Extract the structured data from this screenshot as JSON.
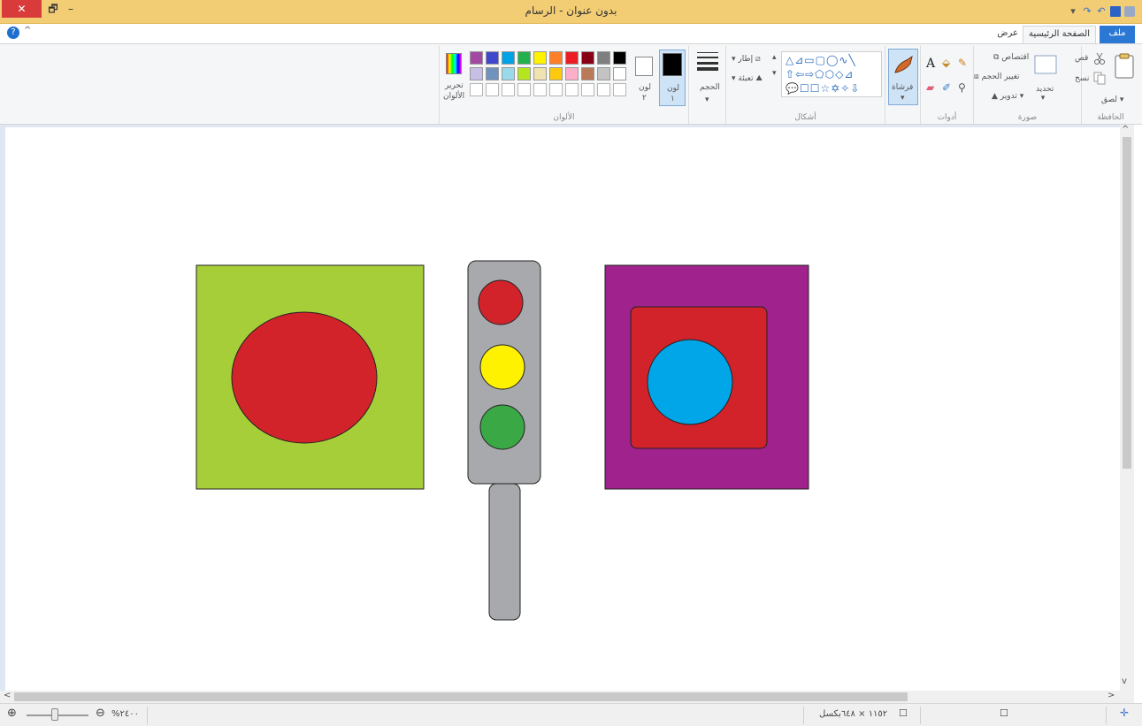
{
  "window": {
    "title": "بدون عنوان - الرسام",
    "close_glyph": "✕",
    "restore_glyph": "🗗",
    "minimize_glyph": "–"
  },
  "tabs": {
    "file": "ملف",
    "home": "الصفحة الرئيسية",
    "view": "عرض"
  },
  "ribbon": {
    "clipboard": {
      "label": "الحافظة",
      "paste": "لصق",
      "cut": "قص",
      "copy": "نسخ"
    },
    "image": {
      "label": "صورة",
      "select": "تحديد",
      "crop": "اقتصاص",
      "resize": "تغيير الحجم",
      "rotate": "تدوير"
    },
    "tools": {
      "label": "أدوات",
      "text_glyph": "A"
    },
    "brushes": {
      "label": "فرشاة"
    },
    "shapes": {
      "label": "أشكال",
      "outline": "إطار",
      "fill": "تعبئة"
    },
    "size": {
      "label": "الحجم"
    },
    "colors": {
      "label": "الألوان",
      "color1": "لون",
      "color1_num": "١",
      "color2": "لون",
      "color2_num": "٢",
      "edit_colors_1": "تحرير",
      "edit_colors_2": "الألوان",
      "palette_row1": [
        "#000000",
        "#7f7f7f",
        "#880015",
        "#ed1c24",
        "#ff7f27",
        "#fff200",
        "#22b14c",
        "#00a2e8",
        "#3f48cc",
        "#a349a4"
      ],
      "palette_row2": [
        "#ffffff",
        "#c3c3c3",
        "#b97a57",
        "#ffaec9",
        "#ffc90e",
        "#efe4b0",
        "#b5e61d",
        "#99d9ea",
        "#7092be",
        "#c8bfe7"
      ]
    }
  },
  "statusbar": {
    "canvas_size": "١١٥٢ × ٦٤٨بكسل",
    "zoom": "٢٤٠٠",
    "zoom_glyph": "%"
  },
  "colors": {
    "titlebar": "#f2cd74",
    "file_tab": "#2b78d4",
    "green_square": "#a6ce39",
    "purple_square": "#a0228c",
    "red": "#d2232a",
    "yellow": "#fff200",
    "green_light": "#3aa845",
    "blue_circle": "#00a6e8",
    "traffic_gray": "#a7a9ac"
  }
}
